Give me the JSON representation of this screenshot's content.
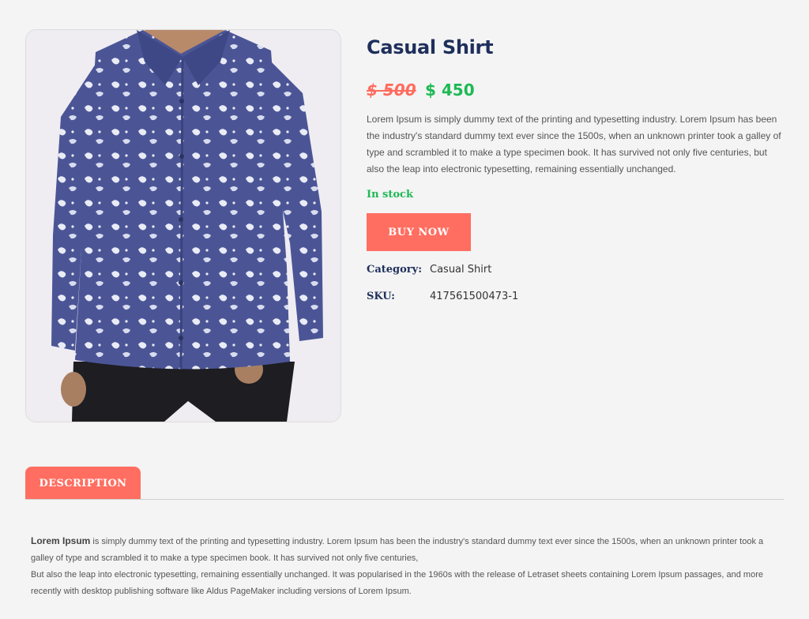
{
  "product": {
    "title": "Casual Shirt",
    "old_price": "$ 500",
    "new_price": "$ 450",
    "short_description": "Lorem Ipsum is simply dummy text of the printing and typesetting industry. Lorem Ipsum has been the industry's standard dummy text ever since the 1500s, when an unknown printer took a galley of type and scrambled it to make a type specimen book. It has survived not only five centuries, but also the leap into electronic typesetting, remaining essentially unchanged.",
    "stock_status": "In stock",
    "buy_label": "BUY NOW",
    "category_label": "Category:",
    "category_value": "Casual Shirt",
    "sku_label": "SKU:",
    "sku_value": "417561500473-1",
    "image_alt": "shirt-photo"
  },
  "tabs": [
    {
      "label": "DESCRIPTION",
      "active": true
    }
  ],
  "description": {
    "lead": "Lorem Ipsum",
    "line1": " is simply dummy text of the printing and typesetting industry. Lorem Ipsum has been the industry's standard dummy text ever since the 1500s, when an unknown printer took a galley of type and scrambled it to make a type specimen book. It has survived not only five centuries,",
    "line2": "But also the leap into electronic typesetting, remaining essentially unchanged. It was popularised in the 1960s with the release of Letraset sheets containing Lorem Ipsum passages, and more recently with desktop publishing software like Aldus PageMaker including versions of Lorem Ipsum."
  },
  "colors": {
    "accent": "#ff6e61",
    "title": "#1f2f5c",
    "success": "#1db954",
    "shirt": "#4b5596"
  }
}
